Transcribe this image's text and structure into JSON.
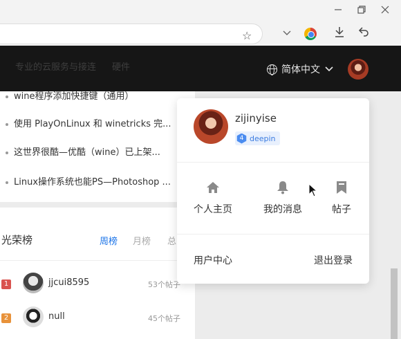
{
  "browser": {
    "icons": [
      "minimize-icon",
      "restore-icon",
      "close-icon",
      "star-icon",
      "chevron-down-icon",
      "chrome-icon",
      "download-icon",
      "back-arrow-icon"
    ]
  },
  "header": {
    "nav_ghost": [
      "专业的云服务与接连",
      "硬件"
    ],
    "language": "简体中文"
  },
  "article_list": [
    "wine程序添加快捷键（通用）",
    "使用 PlayOnLinux 和 winetricks 完...",
    "这世界很酷—优酷（wine）已上架...",
    "Linux操作系统也能PS—Photoshop ..."
  ],
  "ranking": {
    "title": "光荣榜",
    "tabs": [
      "周榜",
      "月榜",
      "总"
    ],
    "rows": [
      {
        "rank": "1",
        "name": "jjcui8595",
        "count": "53个帖子",
        "color": "#d9534f"
      },
      {
        "rank": "2",
        "name": "null",
        "count": "45个帖子",
        "color": "#e8923a"
      }
    ]
  },
  "user_menu": {
    "username": "zijinyise",
    "badge": "deepin",
    "actions": [
      {
        "icon": "home-icon",
        "label": "个人主页"
      },
      {
        "icon": "bell-icon",
        "label": "我的消息"
      },
      {
        "icon": "bookmark-icon",
        "label": "帖子"
      }
    ],
    "user_center": "用户中心",
    "logout": "退出登录"
  },
  "colors": {
    "accent": "#1a73e8",
    "header_bg": "#161616",
    "badge_blue": "#4a8cf0"
  }
}
